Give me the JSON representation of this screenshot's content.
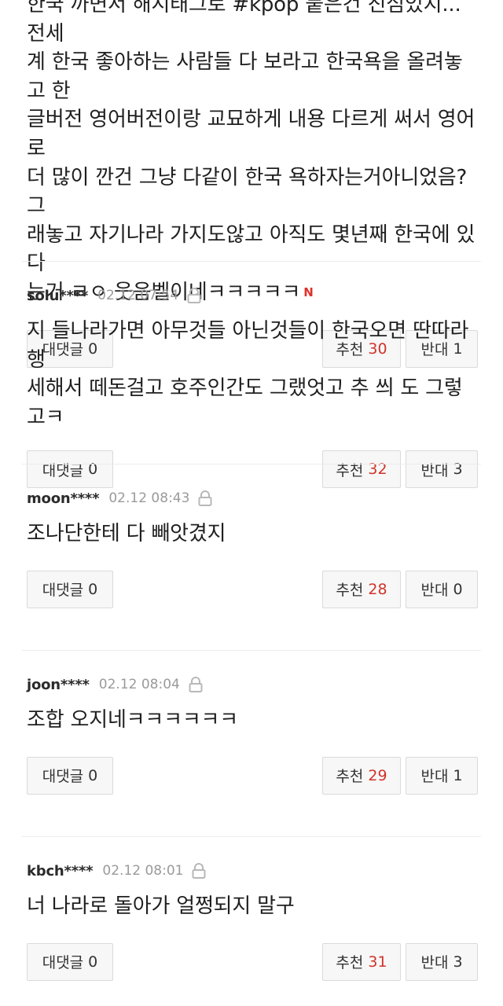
{
  "first_comment": {
    "lines": [
      "한국 까면서 해시태그로 #kpop 붙은건 진심있지... 전세",
      "계 한국 좋아하는 사람들 다 보라고 한국욕을 올려놓고 한",
      "글버전 영어버전이랑 교묘하게 내용 다르게 써서 영어로",
      "더 많이 깐건 그냥 다같이 한국 욕하자는거아니었음? 그",
      "래놓고 자기나라 가지도않고 아직도 몇년째 한국에 있다",
      "는거 ㄹㅇ 웃음벨이네ㅋㅋㅋㅋㅋ"
    ],
    "new_badge": "N",
    "reply_label": "대댓글",
    "reply_count": "0",
    "like_label": "추천",
    "like_count": "30",
    "dislike_label": "반대",
    "dislike_count": "1"
  },
  "comments": [
    {
      "author": "solu****",
      "time": "02.12 07:54",
      "lines": [
        "지 들나라가면 아무것들 아닌것들이 한국오면 딴따라 행",
        "세해서 떼돈걸고 호주인간도 그랬엇고 추 씌 도 그렇고ㅋ"
      ],
      "reply_label": "대댓글",
      "reply_count": "0",
      "like_label": "추천",
      "like_count": "32",
      "dislike_label": "반대",
      "dislike_count": "3"
    },
    {
      "author": "moon****",
      "time": "02.12 08:43",
      "lines": [
        "조나단한테 다 빼앗겼지"
      ],
      "reply_label": "대댓글",
      "reply_count": "0",
      "like_label": "추천",
      "like_count": "28",
      "dislike_label": "반대",
      "dislike_count": "0"
    },
    {
      "author": "joon****",
      "time": "02.12 08:04",
      "lines": [
        "조합 오지네ㅋㅋㅋㅋㅋㅋ"
      ],
      "reply_label": "대댓글",
      "reply_count": "0",
      "like_label": "추천",
      "like_count": "29",
      "dislike_label": "반대",
      "dislike_count": "1"
    },
    {
      "author": "kbch****",
      "time": "02.12 08:01",
      "lines": [
        "너 나라로 돌아가 얼쩡되지 말구"
      ],
      "reply_label": "대댓글",
      "reply_count": "0",
      "like_label": "추천",
      "like_count": "31",
      "dislike_label": "반대",
      "dislike_count": "3"
    }
  ],
  "colors": {
    "like_count": "#d0332c",
    "new_badge": "#e0302a",
    "button_bg": "#f7f7f7",
    "button_border": "#dadada",
    "timestamp": "#9a9a9a"
  },
  "icons": {
    "lock": "lock-icon"
  }
}
